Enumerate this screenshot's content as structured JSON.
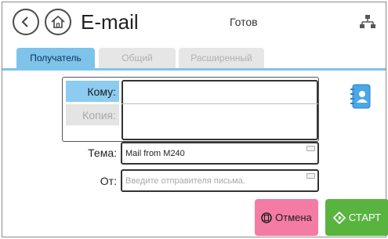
{
  "header": {
    "title": "E-mail",
    "status": "Готов",
    "icons": [
      "back-arrow-icon",
      "home-icon",
      "network-icon"
    ]
  },
  "tabs": [
    {
      "label": "Получатель",
      "active": true
    },
    {
      "label": "Общий",
      "active": false
    },
    {
      "label": "Расширенный",
      "active": false
    }
  ],
  "recipient": {
    "to_label": "Кому:",
    "to_value": "",
    "cc_label": "Копия:",
    "cc_value": ""
  },
  "subject": {
    "label": "Тема:",
    "value": "Mail from M240"
  },
  "from": {
    "label": "От:",
    "value": "",
    "placeholder": "Введите отправителя письма."
  },
  "actions": {
    "cancel_label": "Отмена",
    "start_label": "СТАРТ"
  },
  "colors": {
    "tab_active": "#7ec3ea",
    "cancel": "#f47ba4",
    "start": "#59b43f"
  }
}
